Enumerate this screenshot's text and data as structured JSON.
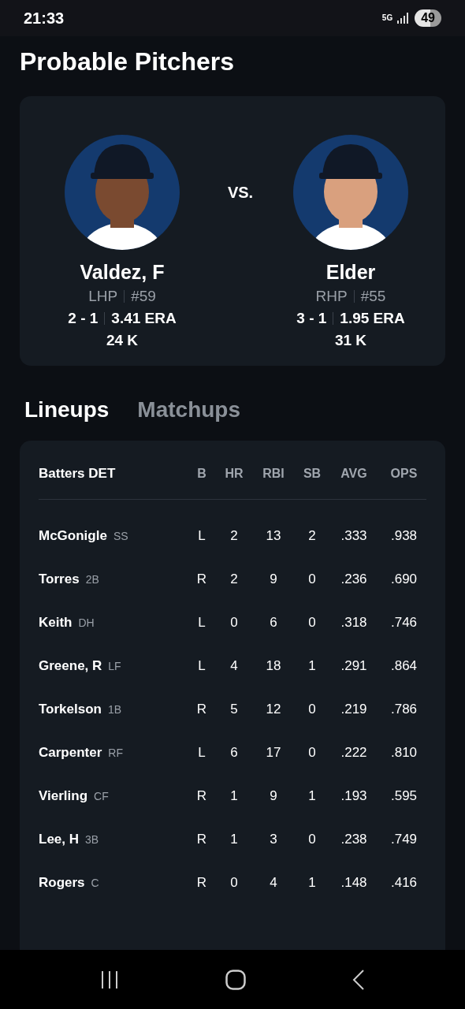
{
  "status_bar": {
    "time": "21:33",
    "network": "5G",
    "battery": "49"
  },
  "title": "Probable Pitchers",
  "pitchers": [
    {
      "name": "Valdez, F",
      "throws": "LHP",
      "number": "#59",
      "record": "2 - 1",
      "era": "3.41 ERA",
      "strikeouts": "24 K"
    },
    {
      "name": "Elder",
      "throws": "RHP",
      "number": "#55",
      "record": "3 - 1",
      "era": "1.95 ERA",
      "strikeouts": "31 K"
    }
  ],
  "versus": "VS.",
  "tabs": [
    {
      "label": "Lineups",
      "selected": true
    },
    {
      "label": "Matchups",
      "selected": false
    }
  ],
  "lineups": [
    {
      "title": "Batters DET",
      "columns": [
        "B",
        "HR",
        "RBI",
        "SB",
        "AVG",
        "OPS"
      ],
      "rows": [
        {
          "name": "McGonigle",
          "position": "SS",
          "cells": [
            "L",
            "2",
            "13",
            "2",
            ".333",
            ".938"
          ]
        },
        {
          "name": "Torres",
          "position": "2B",
          "cells": [
            "R",
            "2",
            "9",
            "0",
            ".236",
            ".690"
          ]
        },
        {
          "name": "Keith",
          "position": "DH",
          "cells": [
            "L",
            "0",
            "6",
            "0",
            ".318",
            ".746"
          ]
        },
        {
          "name": "Greene, R",
          "position": "LF",
          "cells": [
            "L",
            "4",
            "18",
            "1",
            ".291",
            ".864"
          ]
        },
        {
          "name": "Torkelson",
          "position": "1B",
          "cells": [
            "R",
            "5",
            "12",
            "0",
            ".219",
            ".786"
          ]
        },
        {
          "name": "Carpenter",
          "position": "RF",
          "cells": [
            "L",
            "6",
            "17",
            "0",
            ".222",
            ".810"
          ]
        },
        {
          "name": "Vierling",
          "position": "CF",
          "cells": [
            "R",
            "1",
            "9",
            "1",
            ".193",
            ".595"
          ]
        },
        {
          "name": "Lee, H",
          "position": "3B",
          "cells": [
            "R",
            "1",
            "3",
            "0",
            ".238",
            ".749"
          ]
        },
        {
          "name": "Rogers",
          "position": "C",
          "cells": [
            "R",
            "0",
            "4",
            "1",
            ".148",
            ".416"
          ]
        }
      ]
    }
  ]
}
